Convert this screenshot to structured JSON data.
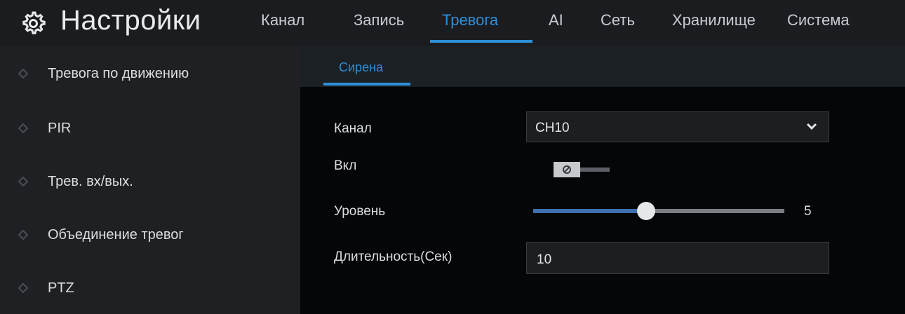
{
  "header": {
    "title": "Настройки",
    "tabs": [
      {
        "label": "Канал",
        "active": false
      },
      {
        "label": "Запись",
        "active": false
      },
      {
        "label": "Тревога",
        "active": true
      },
      {
        "label": "AI",
        "active": false
      },
      {
        "label": "Сеть",
        "active": false
      },
      {
        "label": "Хранилище",
        "active": false
      },
      {
        "label": "Система",
        "active": false
      }
    ]
  },
  "sidebar": {
    "items": [
      {
        "label": "Тревога по движению"
      },
      {
        "label": "PIR"
      },
      {
        "label": "Трев. вх/вых."
      },
      {
        "label": "Объединение тревог"
      },
      {
        "label": "PTZ"
      }
    ]
  },
  "main": {
    "subtab": "Сирена",
    "channel": {
      "label": "Канал",
      "value": "CH10"
    },
    "enable": {
      "label": "Вкл",
      "state": "off"
    },
    "level": {
      "label": "Уровень",
      "value": "5",
      "fraction": 0.45
    },
    "duration": {
      "label": "Длительность(Сек)",
      "value": "10"
    }
  },
  "colors": {
    "accent": "#2c8fd8",
    "background": "#0a0b0d",
    "sidebar": "#1f2024",
    "slider_fill": "#3e6fb0"
  }
}
